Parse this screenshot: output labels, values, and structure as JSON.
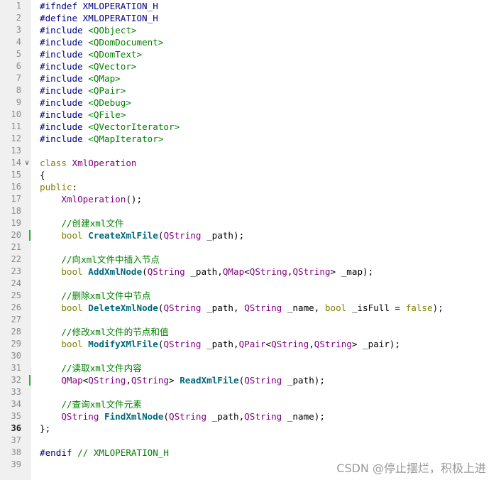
{
  "lines": [
    {
      "n": "1",
      "t": [
        [
          "pp",
          "#ifndef XMLOPERATION_H"
        ]
      ]
    },
    {
      "n": "2",
      "t": [
        [
          "pp",
          "#define XMLOPERATION_H"
        ]
      ]
    },
    {
      "n": "3",
      "t": [
        [
          "pp",
          "#include "
        ],
        [
          "inc",
          "<QObject>"
        ]
      ]
    },
    {
      "n": "4",
      "t": [
        [
          "pp",
          "#include "
        ],
        [
          "inc",
          "<QDomDocument>"
        ]
      ]
    },
    {
      "n": "5",
      "t": [
        [
          "pp",
          "#include "
        ],
        [
          "inc",
          "<QDomText>"
        ]
      ]
    },
    {
      "n": "6",
      "t": [
        [
          "pp",
          "#include "
        ],
        [
          "inc",
          "<QVector>"
        ]
      ]
    },
    {
      "n": "7",
      "t": [
        [
          "pp",
          "#include "
        ],
        [
          "inc",
          "<QMap>"
        ]
      ]
    },
    {
      "n": "8",
      "t": [
        [
          "pp",
          "#include "
        ],
        [
          "inc",
          "<QPair>"
        ]
      ]
    },
    {
      "n": "9",
      "t": [
        [
          "pp",
          "#include "
        ],
        [
          "inc",
          "<QDebug>"
        ]
      ]
    },
    {
      "n": "10",
      "t": [
        [
          "pp",
          "#include "
        ],
        [
          "inc",
          "<QFile>"
        ]
      ]
    },
    {
      "n": "11",
      "t": [
        [
          "pp",
          "#include "
        ],
        [
          "inc",
          "<QVectorIterator>"
        ]
      ]
    },
    {
      "n": "12",
      "t": [
        [
          "pp",
          "#include "
        ],
        [
          "inc",
          "<QMapIterator>"
        ]
      ]
    },
    {
      "n": "13",
      "t": []
    },
    {
      "n": "14",
      "fold": true,
      "t": [
        [
          "kw",
          "class "
        ],
        [
          "cls",
          "XmlOperation"
        ]
      ]
    },
    {
      "n": "15",
      "t": [
        [
          "plain",
          "{"
        ]
      ]
    },
    {
      "n": "16",
      "t": [
        [
          "kw",
          "public"
        ],
        [
          "plain",
          ":"
        ]
      ]
    },
    {
      "n": "17",
      "t": [
        [
          "plain",
          "    "
        ],
        [
          "cls",
          "XmlOperation"
        ],
        [
          "plain",
          "();"
        ]
      ]
    },
    {
      "n": "18",
      "t": []
    },
    {
      "n": "19",
      "t": [
        [
          "plain",
          "    "
        ],
        [
          "cm",
          "//创建xml文件"
        ]
      ]
    },
    {
      "n": "20",
      "mark": true,
      "t": [
        [
          "plain",
          "    "
        ],
        [
          "kw",
          "bool "
        ],
        [
          "fn",
          "CreateXmlFile"
        ],
        [
          "plain",
          "("
        ],
        [
          "cls",
          "QString"
        ],
        [
          "plain",
          " _path);"
        ]
      ]
    },
    {
      "n": "21",
      "t": []
    },
    {
      "n": "22",
      "t": [
        [
          "plain",
          "    "
        ],
        [
          "cm",
          "//向xml文件中插入节点"
        ]
      ]
    },
    {
      "n": "23",
      "t": [
        [
          "plain",
          "    "
        ],
        [
          "kw",
          "bool "
        ],
        [
          "fn",
          "AddXmlNode"
        ],
        [
          "plain",
          "("
        ],
        [
          "cls",
          "QString"
        ],
        [
          "plain",
          " _path,"
        ],
        [
          "cls",
          "QMap"
        ],
        [
          "plain",
          "<"
        ],
        [
          "cls",
          "QString"
        ],
        [
          "plain",
          ","
        ],
        [
          "cls",
          "QString"
        ],
        [
          "plain",
          "> _map);"
        ]
      ]
    },
    {
      "n": "24",
      "t": []
    },
    {
      "n": "25",
      "t": [
        [
          "plain",
          "    "
        ],
        [
          "cm",
          "//删除xml文件中节点"
        ]
      ]
    },
    {
      "n": "26",
      "t": [
        [
          "plain",
          "    "
        ],
        [
          "kw",
          "bool "
        ],
        [
          "fn",
          "DeleteXmlNode"
        ],
        [
          "plain",
          "("
        ],
        [
          "cls",
          "QString"
        ],
        [
          "plain",
          " _path, "
        ],
        [
          "cls",
          "QString"
        ],
        [
          "plain",
          " _name, "
        ],
        [
          "kw",
          "bool"
        ],
        [
          "plain",
          " _isFull = "
        ],
        [
          "kw",
          "false"
        ],
        [
          "plain",
          ");"
        ]
      ]
    },
    {
      "n": "27",
      "t": []
    },
    {
      "n": "28",
      "t": [
        [
          "plain",
          "    "
        ],
        [
          "cm",
          "//修改xml文件的节点和值"
        ]
      ]
    },
    {
      "n": "29",
      "t": [
        [
          "plain",
          "    "
        ],
        [
          "kw",
          "bool "
        ],
        [
          "fn",
          "ModifyXMlFile"
        ],
        [
          "plain",
          "("
        ],
        [
          "cls",
          "QString"
        ],
        [
          "plain",
          " _path,"
        ],
        [
          "cls",
          "QPair"
        ],
        [
          "plain",
          "<"
        ],
        [
          "cls",
          "QString"
        ],
        [
          "plain",
          ","
        ],
        [
          "cls",
          "QString"
        ],
        [
          "plain",
          "> _pair);"
        ]
      ]
    },
    {
      "n": "30",
      "t": []
    },
    {
      "n": "31",
      "t": [
        [
          "plain",
          "    "
        ],
        [
          "cm",
          "//读取xml文件内容"
        ]
      ]
    },
    {
      "n": "32",
      "mark": true,
      "t": [
        [
          "plain",
          "    "
        ],
        [
          "cls",
          "QMap"
        ],
        [
          "plain",
          "<"
        ],
        [
          "cls",
          "QString"
        ],
        [
          "plain",
          ","
        ],
        [
          "cls",
          "QString"
        ],
        [
          "plain",
          "> "
        ],
        [
          "fn",
          "ReadXmlFile"
        ],
        [
          "plain",
          "("
        ],
        [
          "cls",
          "QString"
        ],
        [
          "plain",
          " _path);"
        ]
      ]
    },
    {
      "n": "33",
      "t": []
    },
    {
      "n": "34",
      "t": [
        [
          "plain",
          "    "
        ],
        [
          "cm",
          "//查询xml文件元素"
        ]
      ]
    },
    {
      "n": "35",
      "t": [
        [
          "plain",
          "    "
        ],
        [
          "cls",
          "QString"
        ],
        [
          "plain",
          " "
        ],
        [
          "fn",
          "FindXmlNode"
        ],
        [
          "plain",
          "("
        ],
        [
          "cls",
          "QString"
        ],
        [
          "plain",
          " _path,"
        ],
        [
          "cls",
          "QString"
        ],
        [
          "plain",
          " _name);"
        ]
      ]
    },
    {
      "n": "36",
      "bold": true,
      "t": [
        [
          "plain",
          "};"
        ]
      ]
    },
    {
      "n": "37",
      "t": []
    },
    {
      "n": "38",
      "t": [
        [
          "pp",
          "#endif "
        ],
        [
          "cm",
          "// XMLOPERATION_H"
        ]
      ]
    },
    {
      "n": "39",
      "t": []
    }
  ],
  "watermark": "CSDN @停止摆烂，积极上进"
}
